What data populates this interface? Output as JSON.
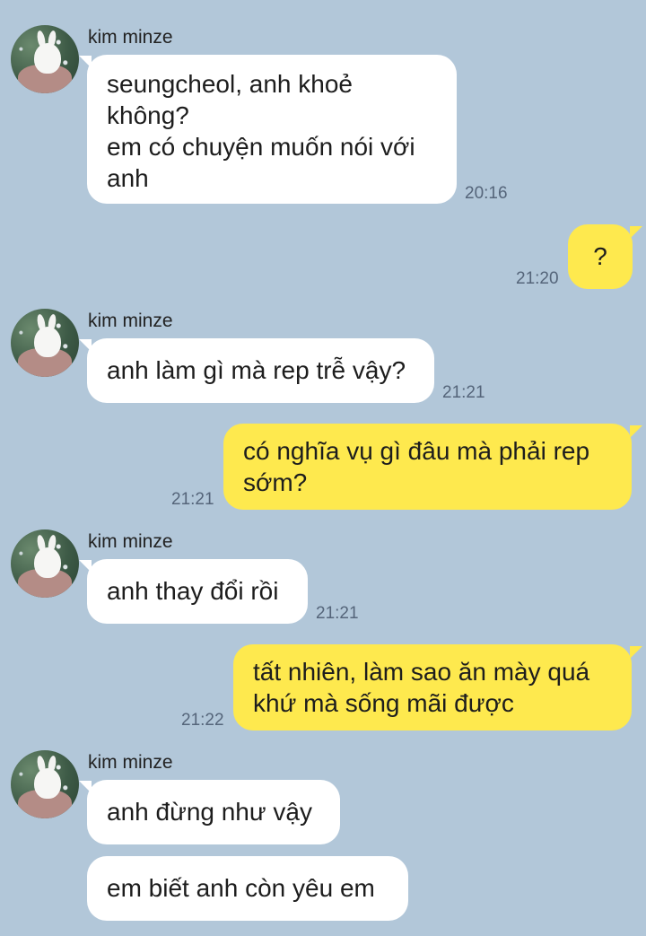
{
  "contact_name": "kim minze",
  "messages": [
    {
      "dir": "in",
      "text": "seungcheol, anh khoẻ\nkhông?\nem có chuyện muốn nói với\nanh",
      "time": "20:16"
    },
    {
      "dir": "out",
      "text": "?",
      "time": "21:20"
    },
    {
      "dir": "in",
      "text": "anh làm gì mà rep trễ vậy?",
      "time": "21:21"
    },
    {
      "dir": "out",
      "text": "có nghĩa vụ gì đâu mà phải rep\nsớm?",
      "time": "21:21"
    },
    {
      "dir": "in",
      "text": "anh thay đổi rồi",
      "time": "21:21"
    },
    {
      "dir": "out",
      "text": "tất nhiên, làm sao ăn mày quá\nkhứ mà sống mãi được",
      "time": "21:22"
    },
    {
      "dir": "in",
      "text": "anh đừng như vậy",
      "time": ""
    },
    {
      "dir": "in",
      "text": "em biết anh còn yêu em",
      "time": ""
    }
  ],
  "colors": {
    "background": "#b2c7d9",
    "incoming_bubble": "#ffffff",
    "outgoing_bubble": "#fee94e"
  }
}
